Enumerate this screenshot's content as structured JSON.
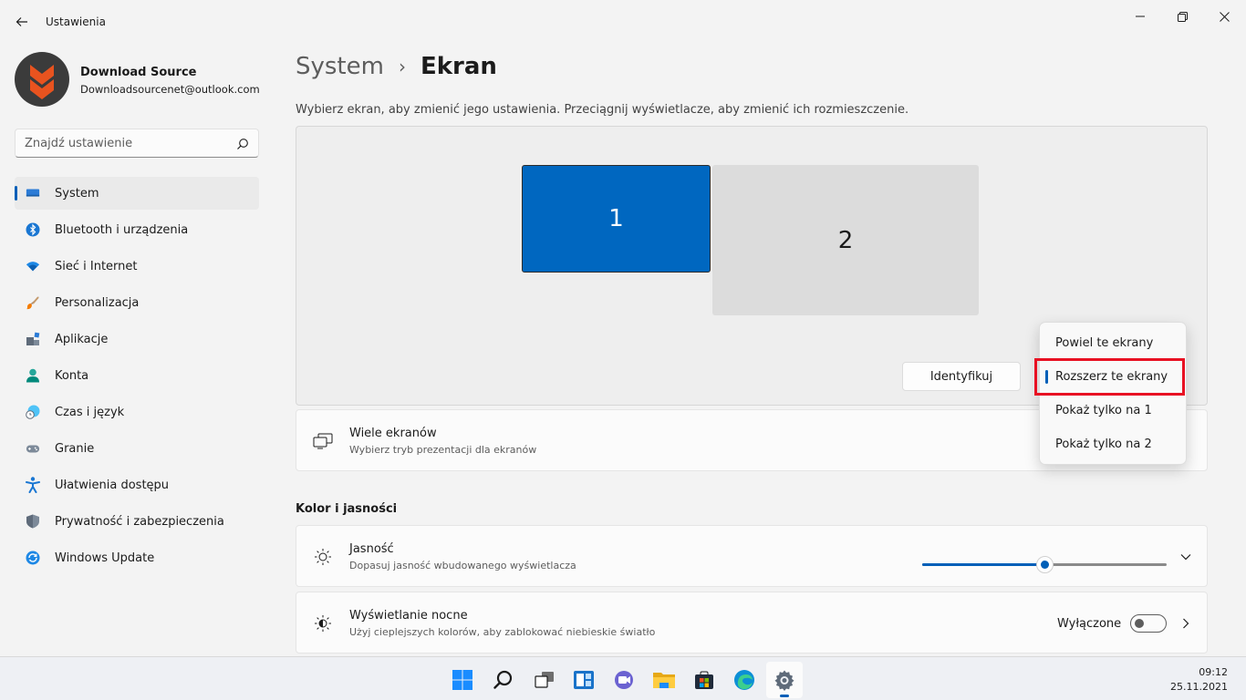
{
  "window": {
    "title": "Ustawienia"
  },
  "profile": {
    "name": "Download Source",
    "email": "Downloadsourcenet@outlook.com"
  },
  "search": {
    "placeholder": "Znajdź ustawienie"
  },
  "nav": {
    "items": [
      {
        "label": "System",
        "icon": "display-icon",
        "active": true
      },
      {
        "label": "Bluetooth i urządzenia",
        "icon": "bluetooth-icon"
      },
      {
        "label": "Sieć i Internet",
        "icon": "wifi-icon"
      },
      {
        "label": "Personalizacja",
        "icon": "brush-icon"
      },
      {
        "label": "Aplikacje",
        "icon": "apps-icon"
      },
      {
        "label": "Konta",
        "icon": "account-icon"
      },
      {
        "label": "Czas i język",
        "icon": "clock-globe-icon"
      },
      {
        "label": "Granie",
        "icon": "gamepad-icon"
      },
      {
        "label": "Ułatwienia dostępu",
        "icon": "accessibility-icon"
      },
      {
        "label": "Prywatność i zabezpieczenia",
        "icon": "shield-icon"
      },
      {
        "label": "Windows Update",
        "icon": "update-icon"
      }
    ]
  },
  "breadcrumb": {
    "parent": "System",
    "separator": "›",
    "current": "Ekran"
  },
  "display": {
    "subtitle": "Wybierz ekran, aby zmienić jego ustawienia. Przeciągnij wyświetlacze, aby zmienić ich rozmieszczenie.",
    "monitor_1": "1",
    "monitor_2": "2",
    "identify_label": "Identyfikuj"
  },
  "multiple_displays": {
    "title": "Wiele ekranów",
    "description": "Wybierz tryb prezentacji dla ekranów"
  },
  "dropdown": {
    "options": [
      {
        "label": "Powiel te ekrany",
        "selected": false
      },
      {
        "label": "Rozszerz te ekrany",
        "selected": true
      },
      {
        "label": "Pokaż tylko na 1",
        "selected": false
      },
      {
        "label": "Pokaż tylko na 2",
        "selected": false
      }
    ]
  },
  "color_section": {
    "title": "Kolor i jasności"
  },
  "brightness": {
    "title": "Jasność",
    "description": "Dopasuj jasność wbudowanego wyświetlacza",
    "level_percent": 50
  },
  "night_light": {
    "title": "Wyświetlanie nocne",
    "description": "Użyj cieplejszych kolorów, aby zablokować niebieskie światło",
    "state_label": "Wyłączone",
    "on": false
  },
  "taskbar": {
    "icons": [
      "windows-start-icon",
      "search-icon",
      "task-view-icon",
      "widgets-icon",
      "teams-chat-icon",
      "file-explorer-icon",
      "store-icon",
      "edge-icon",
      "settings-icon"
    ],
    "time": "09:12",
    "date": "25.11.2021"
  },
  "colors": {
    "accent": "#005fb8",
    "monitor_selected": "#0067c0",
    "highlight_box": "#e81123"
  }
}
